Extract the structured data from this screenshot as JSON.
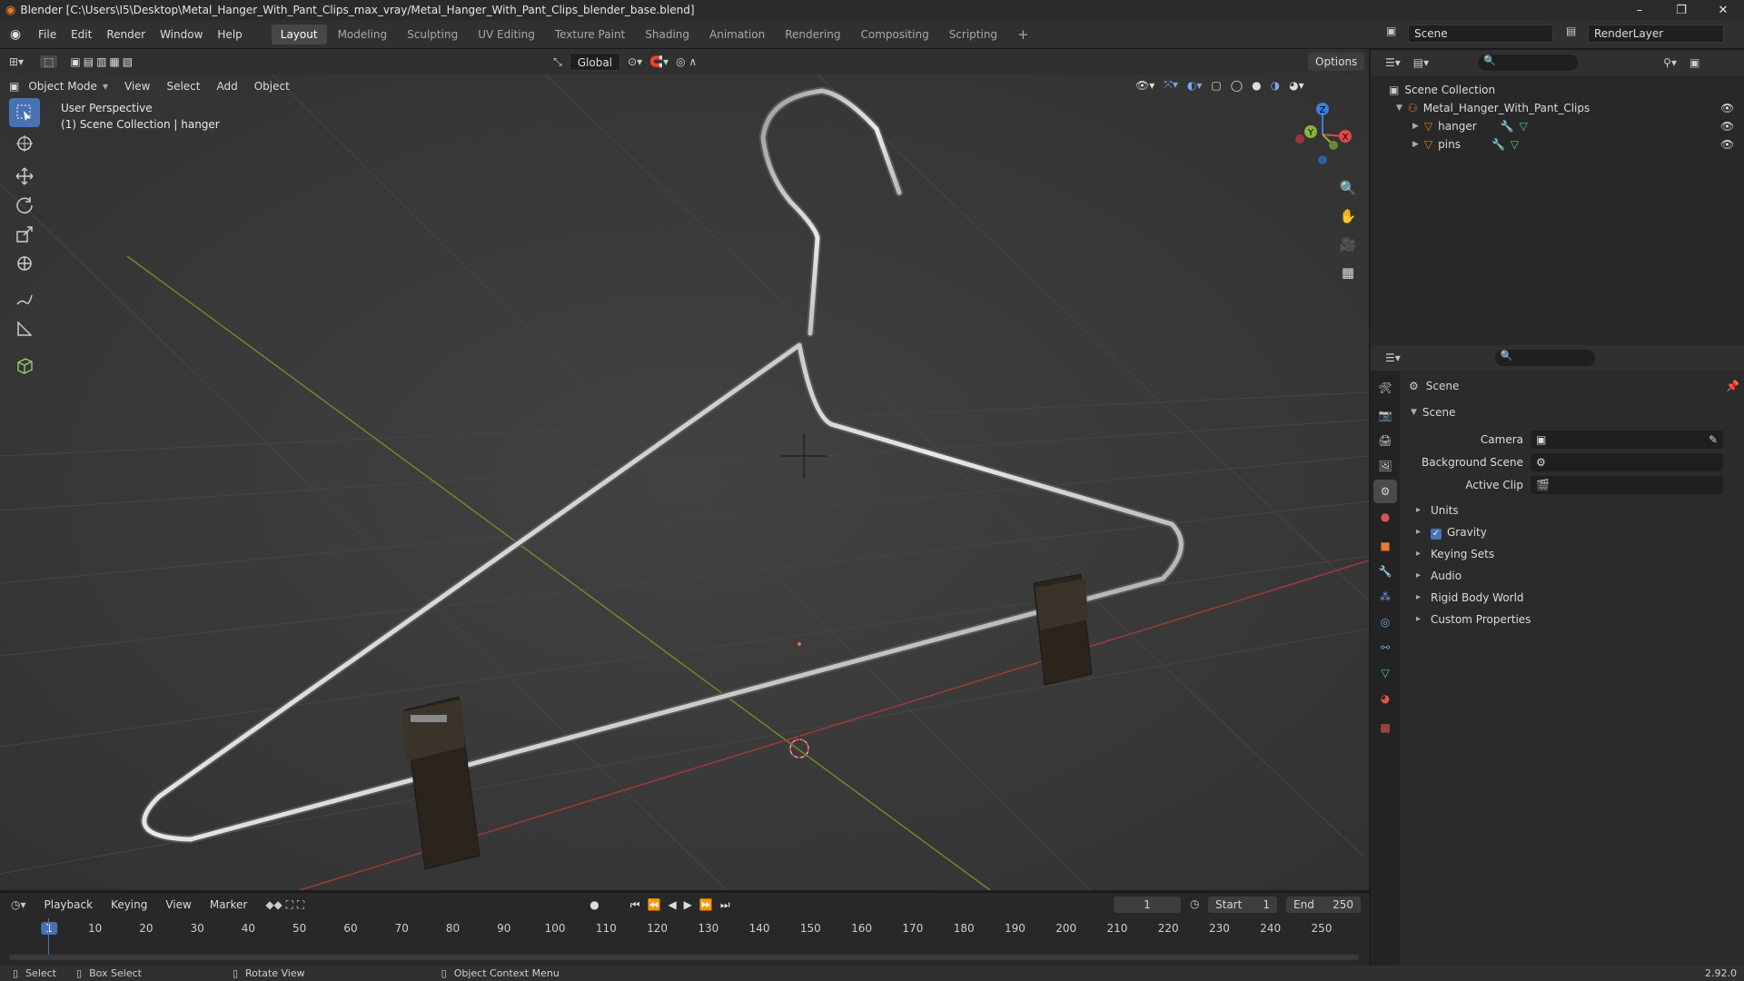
{
  "window": {
    "title": "Blender [C:\\Users\\I5\\Desktop\\Metal_Hanger_With_Pant_Clips_max_vray/Metal_Hanger_With_Pant_Clips_blender_base.blend]",
    "min": "–",
    "max": "❐",
    "close": "✕"
  },
  "menu": {
    "items": [
      "File",
      "Edit",
      "Render",
      "Window",
      "Help"
    ]
  },
  "workspaces": [
    "Layout",
    "Modeling",
    "Sculpting",
    "UV Editing",
    "Texture Paint",
    "Shading",
    "Animation",
    "Rendering",
    "Compositing",
    "Scripting"
  ],
  "workspace_add": "+",
  "top_right": {
    "scene": "Scene",
    "renderlayer": "RenderLayer"
  },
  "viewport": {
    "mode": "Object Mode",
    "menus": [
      "View",
      "Select",
      "Add",
      "Object"
    ],
    "orientation": "Global",
    "options": "Options",
    "overlay_line1": "User Perspective",
    "overlay_line2": "(1) Scene Collection | hanger",
    "gizmo_x": "X",
    "gizmo_y": "Y",
    "gizmo_z": "Z"
  },
  "outliner": {
    "root": "Scene Collection",
    "collection": "Metal_Hanger_With_Pant_Clips",
    "objects": [
      "hanger",
      "pins"
    ]
  },
  "properties": {
    "header": "Scene",
    "section": "Scene",
    "camera_label": "Camera",
    "bg_label": "Background Scene",
    "clip_label": "Active Clip",
    "panels": [
      "Units",
      "Gravity",
      "Keying Sets",
      "Audio",
      "Rigid Body World",
      "Custom Properties"
    ]
  },
  "timeline": {
    "menus": [
      "Playback",
      "Keying",
      "View",
      "Marker"
    ],
    "current_frame": "1",
    "start_label": "Start",
    "start": "1",
    "end_label": "End",
    "end": "250",
    "ticks": [
      "1",
      "10",
      "20",
      "30",
      "40",
      "50",
      "60",
      "70",
      "80",
      "90",
      "100",
      "110",
      "120",
      "130",
      "140",
      "150",
      "160",
      "170",
      "180",
      "190",
      "200",
      "210",
      "220",
      "230",
      "240",
      "250"
    ]
  },
  "status": {
    "select": "Select",
    "box": "Box Select",
    "rotate": "Rotate View",
    "context": "Object Context Menu",
    "version": "2.92.0"
  },
  "colors": {
    "accent": "#4772b3",
    "orange": "#e77b2f",
    "x_axis": "#e0474a",
    "y_axis": "#8bb33a",
    "z_axis": "#3c7fd9"
  }
}
